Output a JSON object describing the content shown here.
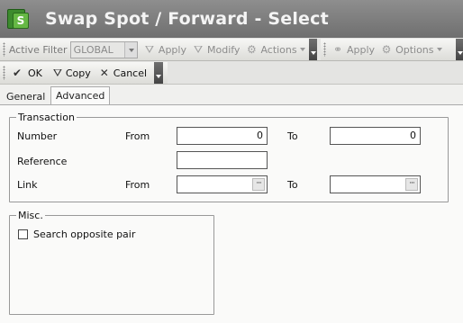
{
  "window": {
    "title": "Swap Spot / Forward - Select"
  },
  "toolbar1": {
    "filter_label": "Active Filter",
    "filter_value": "GLOBAL",
    "apply_label": "Apply",
    "modify_label": "Modify",
    "actions_label": "Actions",
    "apply2_label": "Apply",
    "options_label": "Options"
  },
  "toolbar2": {
    "ok_label": "OK",
    "copy_label": "Copy",
    "cancel_label": "Cancel"
  },
  "tabs": [
    {
      "label": "General",
      "active": false
    },
    {
      "label": "Advanced",
      "active": true
    }
  ],
  "transaction": {
    "legend": "Transaction",
    "number_label": "Number",
    "from_label": "From",
    "to_label": "To",
    "number_from": "0",
    "number_to": "0",
    "reference_label": "Reference",
    "reference_value": "",
    "link_label": "Link",
    "link_from_label": "From",
    "link_to_label": "To",
    "link_from": "",
    "link_to": "",
    "lookup_glyph": "···"
  },
  "misc": {
    "legend": "Misc.",
    "search_opposite_label": "Search opposite pair",
    "search_opposite_checked": false
  }
}
